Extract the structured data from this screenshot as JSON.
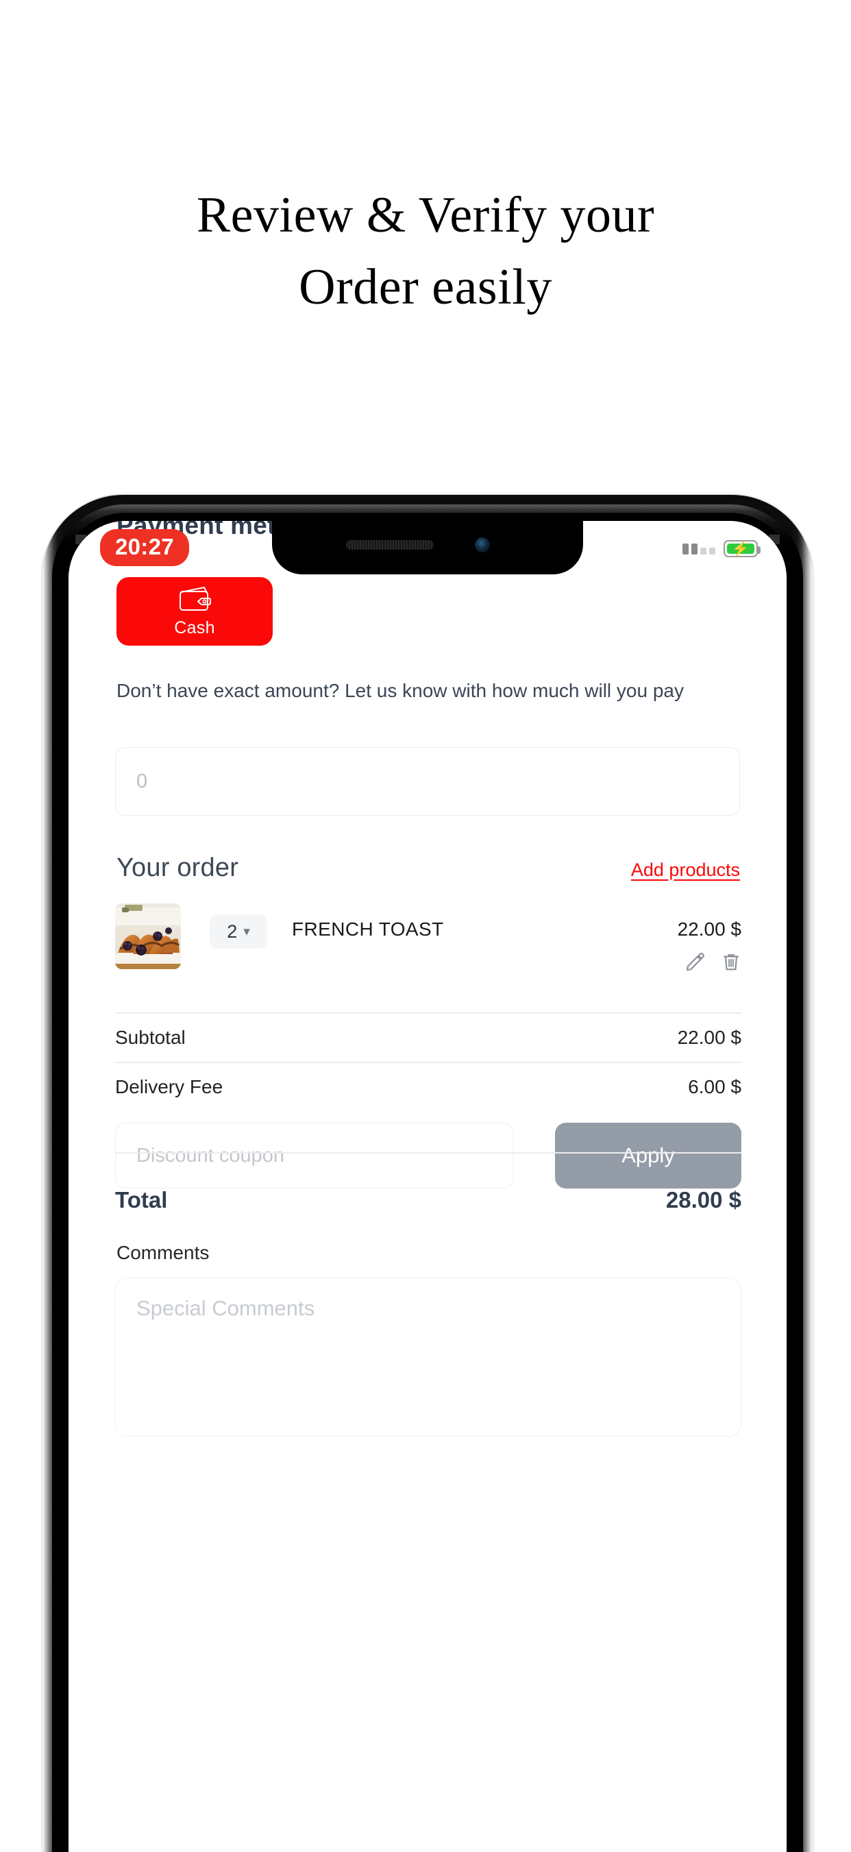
{
  "marketing": {
    "headline_line1": "Review & Verify your",
    "headline_line2": "Order easily"
  },
  "status_bar": {
    "time": "20:27",
    "signal_icon": "signal-bars-icon",
    "battery_icon": "battery-charging-icon"
  },
  "screen": {
    "section_payment_title": "Payment method",
    "payment_methods": [
      {
        "label": "Cash",
        "icon": "wallet-icon",
        "selected": true,
        "color": "#FB0808"
      }
    ],
    "exact_amount_hint": "Don’t have exact amount? Let us know with how much will you pay",
    "amount_input": {
      "value": "",
      "placeholder": "0"
    },
    "order": {
      "title": "Your order",
      "add_products_link": "Add products",
      "items": [
        {
          "thumbnail": "french-toast-photo",
          "quantity": "2",
          "name": "FRENCH TOAST",
          "price": "22.00 $",
          "edit_icon": "pencil-icon",
          "delete_icon": "trash-icon"
        }
      ]
    },
    "summary": {
      "subtotal_label": "Subtotal",
      "subtotal_value": "22.00 $",
      "delivery_label": "Delivery Fee",
      "delivery_value": "6.00 $",
      "total_label": "Total",
      "total_value": "28.00 $"
    },
    "coupon": {
      "placeholder": "Discount coupon",
      "value": "",
      "apply_label": "Apply",
      "apply_color": "#949CA8"
    },
    "comments": {
      "label": "Comments",
      "placeholder": "Special Comments",
      "value": ""
    }
  },
  "colors": {
    "brand_red": "#FB0808",
    "time_pill_red": "#EE3124",
    "heading_slate": "#313d4f",
    "muted_gray": "#949CA8",
    "battery_green": "#2ECC40"
  }
}
